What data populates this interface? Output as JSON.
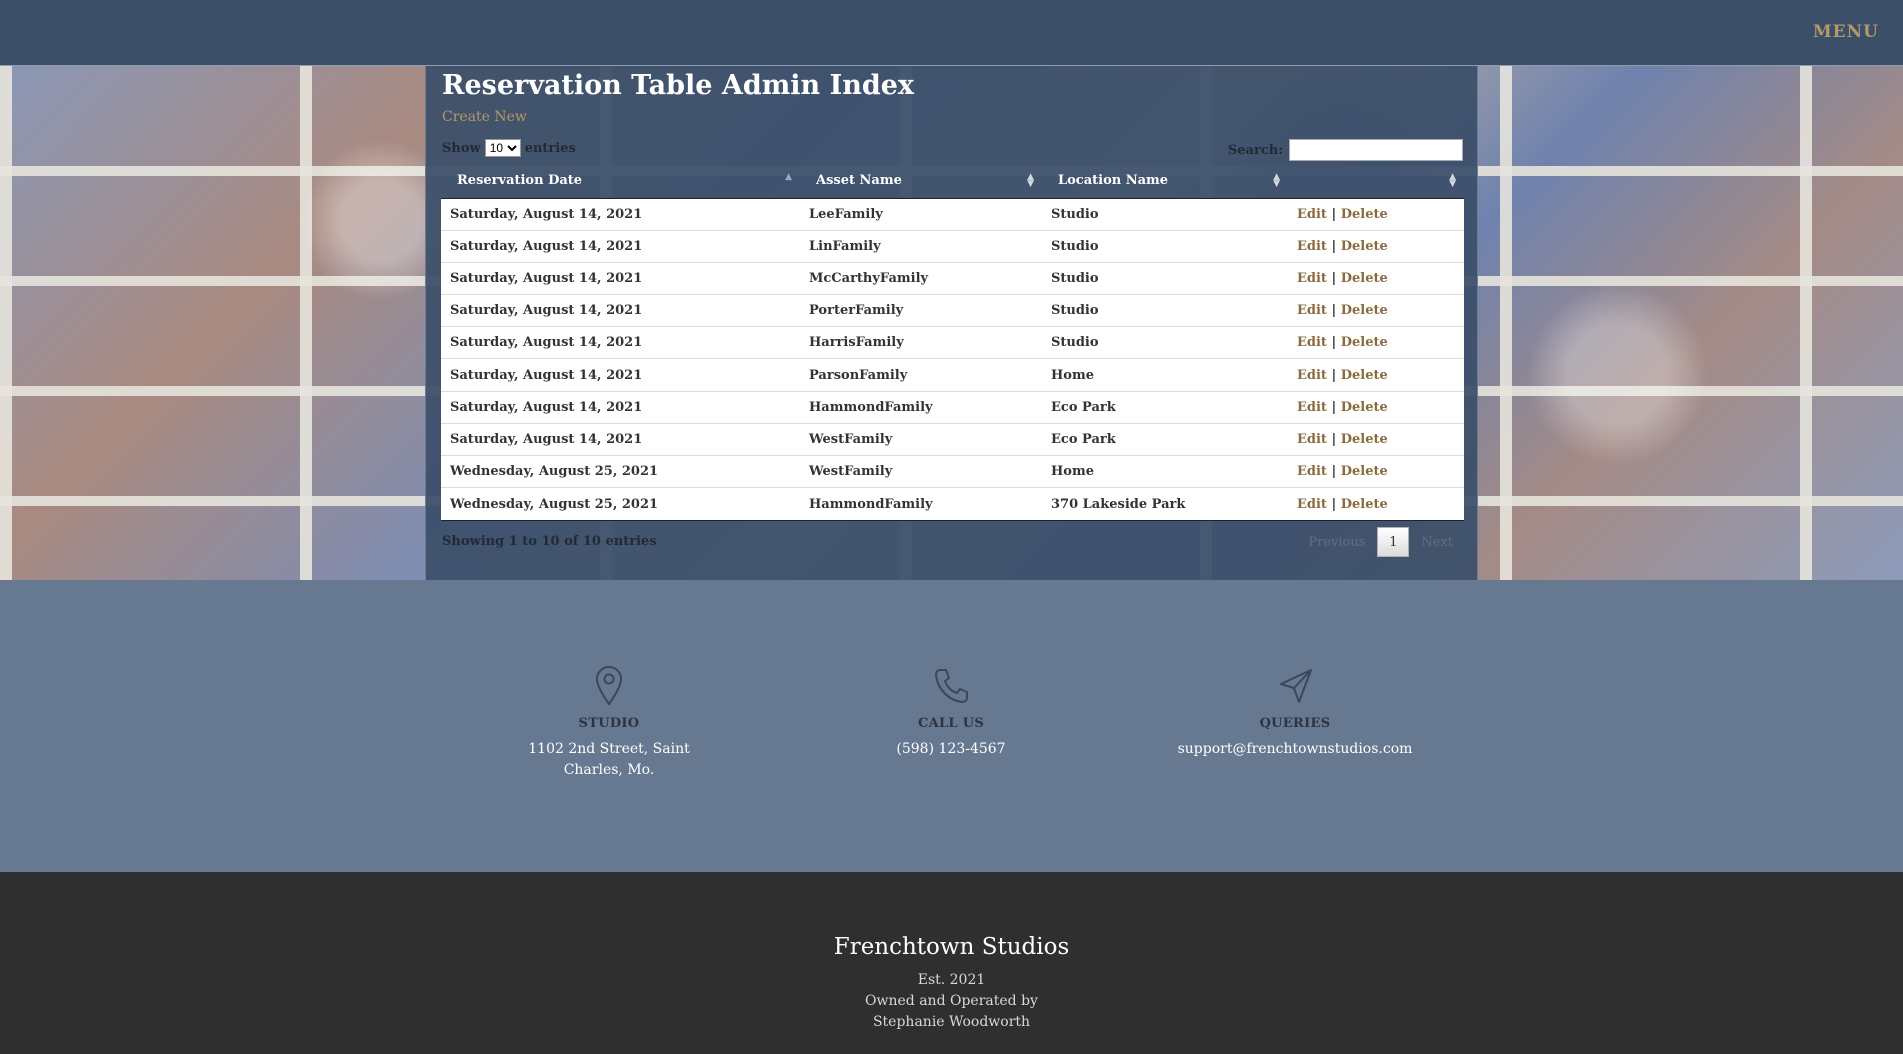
{
  "nav": {
    "menu_label": "MENU"
  },
  "page": {
    "title": "Reservation Table Admin Index",
    "create_label": "Create New"
  },
  "controls": {
    "show_label": "Show",
    "entries_label": "entries",
    "page_length": "10",
    "search_label": "Search:",
    "search_value": ""
  },
  "table": {
    "columns": [
      "Reservation Date",
      "Asset Name",
      "Location Name",
      ""
    ],
    "rows": [
      [
        "Saturday, August 14, 2021",
        "LeeFamily",
        "Studio"
      ],
      [
        "Saturday, August 14, 2021",
        "LinFamily",
        "Studio"
      ],
      [
        "Saturday, August 14, 2021",
        "McCarthyFamily",
        "Studio"
      ],
      [
        "Saturday, August 14, 2021",
        "PorterFamily",
        "Studio"
      ],
      [
        "Saturday, August 14, 2021",
        "HarrisFamily",
        "Studio"
      ],
      [
        "Saturday, August 14, 2021",
        "ParsonFamily",
        "Home"
      ],
      [
        "Saturday, August 14, 2021",
        "HammondFamily",
        "Eco Park"
      ],
      [
        "Saturday, August 14, 2021",
        "WestFamily",
        "Eco Park"
      ],
      [
        "Wednesday, August 25, 2021",
        "WestFamily",
        "Home"
      ],
      [
        "Wednesday, August 25, 2021",
        "HammondFamily",
        "370 Lakeside Park"
      ]
    ],
    "edit_label": "Edit",
    "delete_label": "Delete",
    "separator": "|",
    "sorted_column": "Reservation Date",
    "sort_direction": "ascending"
  },
  "pagination": {
    "info": "Showing 1 to 10 of 10 entries",
    "previous_label": "Previous",
    "current_page": "1",
    "next_label": "Next"
  },
  "contact": {
    "studio": {
      "icon": "map-pin-icon",
      "label": "STUDIO",
      "line1": "1102 2nd Street, Saint",
      "line2": "Charles, Mo."
    },
    "call": {
      "icon": "phone-icon",
      "label": "CALL US",
      "value": "(598) 123-4567"
    },
    "queries": {
      "icon": "paper-plane-icon",
      "label": "QUERIES",
      "value": "support@frenchtownstudios.com"
    }
  },
  "footer": {
    "brand": "Frenchtown Studios",
    "established": "Est. 2021",
    "owned_line1": "Owned and Operated by",
    "owned_line2": "Stephanie Woodworth"
  },
  "colors": {
    "nav_bg": "#3b4f69",
    "accent_gold": "#b5986a",
    "contact_bg": "#677891",
    "footer_bg": "#2f2f2f"
  }
}
